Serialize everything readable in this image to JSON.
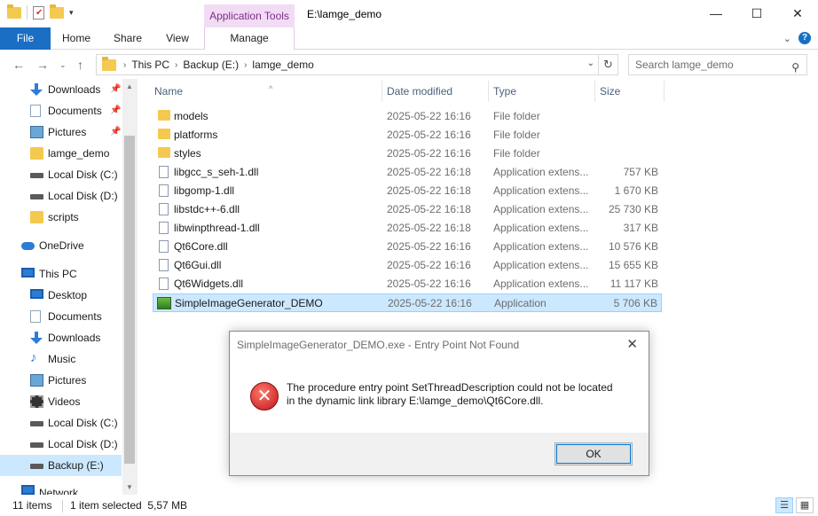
{
  "window": {
    "title": "E:\\lamge_demo",
    "context_tab": "Application Tools",
    "controls": {
      "minimize": "—",
      "maximize": "☐",
      "close": "✕"
    }
  },
  "ribbon": {
    "tabs": [
      "File",
      "Home",
      "Share",
      "View",
      "Manage"
    ]
  },
  "address": {
    "crumbs": [
      "This PC",
      "Backup (E:)",
      "lamge_demo"
    ],
    "search_placeholder": "Search lamge_demo"
  },
  "sidebar": {
    "items": [
      {
        "label": "Downloads",
        "icon": "download-icon",
        "pinned": true
      },
      {
        "label": "Documents",
        "icon": "document-icon",
        "pinned": true
      },
      {
        "label": "Pictures",
        "icon": "pictures-icon",
        "pinned": true
      },
      {
        "label": "lamge_demo",
        "icon": "folder-icon"
      },
      {
        "label": "Local Disk (C:)",
        "icon": "disk-icon"
      },
      {
        "label": "Local Disk (D:)",
        "icon": "disk-icon"
      },
      {
        "label": "scripts",
        "icon": "folder-icon"
      },
      {
        "label": "OneDrive",
        "icon": "onedrive-icon"
      },
      {
        "label": "This PC",
        "icon": "pc-icon"
      },
      {
        "label": "Desktop",
        "icon": "desktop-icon"
      },
      {
        "label": "Documents",
        "icon": "document-icon"
      },
      {
        "label": "Downloads",
        "icon": "download-icon"
      },
      {
        "label": "Music",
        "icon": "music-icon"
      },
      {
        "label": "Pictures",
        "icon": "pictures-icon"
      },
      {
        "label": "Videos",
        "icon": "videos-icon"
      },
      {
        "label": "Local Disk (C:)",
        "icon": "disk-icon"
      },
      {
        "label": "Local Disk (D:)",
        "icon": "disk-icon"
      },
      {
        "label": "Backup (E:)",
        "icon": "disk-icon",
        "selected": true
      },
      {
        "label": "Network",
        "icon": "network-icon"
      }
    ]
  },
  "columns": {
    "name": "Name",
    "date": "Date modified",
    "type": "Type",
    "size": "Size"
  },
  "files": [
    {
      "name": "models",
      "date": "2025-05-22 16:16",
      "type": "File folder",
      "size": "",
      "kind": "folder"
    },
    {
      "name": "platforms",
      "date": "2025-05-22 16:16",
      "type": "File folder",
      "size": "",
      "kind": "folder"
    },
    {
      "name": "styles",
      "date": "2025-05-22 16:16",
      "type": "File folder",
      "size": "",
      "kind": "folder"
    },
    {
      "name": "libgcc_s_seh-1.dll",
      "date": "2025-05-22 16:18",
      "type": "Application extens...",
      "size": "757 KB",
      "kind": "dll"
    },
    {
      "name": "libgomp-1.dll",
      "date": "2025-05-22 16:18",
      "type": "Application extens...",
      "size": "1 670 KB",
      "kind": "dll"
    },
    {
      "name": "libstdc++-6.dll",
      "date": "2025-05-22 16:18",
      "type": "Application extens...",
      "size": "25 730 KB",
      "kind": "dll"
    },
    {
      "name": "libwinpthread-1.dll",
      "date": "2025-05-22 16:18",
      "type": "Application extens...",
      "size": "317 KB",
      "kind": "dll"
    },
    {
      "name": "Qt6Core.dll",
      "date": "2025-05-22 16:16",
      "type": "Application extens...",
      "size": "10 576 KB",
      "kind": "dll"
    },
    {
      "name": "Qt6Gui.dll",
      "date": "2025-05-22 16:16",
      "type": "Application extens...",
      "size": "15 655 KB",
      "kind": "dll"
    },
    {
      "name": "Qt6Widgets.dll",
      "date": "2025-05-22 16:16",
      "type": "Application extens...",
      "size": "11 117 KB",
      "kind": "dll"
    },
    {
      "name": "SimpleImageGenerator_DEMO",
      "date": "2025-05-22 16:16",
      "type": "Application",
      "size": "5 706 KB",
      "kind": "exe",
      "selected": true
    }
  ],
  "status": {
    "count": "11 items",
    "selection": "1 item selected  5,57 MB"
  },
  "dialog": {
    "title": "SimpleImageGenerator_DEMO.exe - Entry Point Not Found",
    "message_line1": "The procedure entry point SetThreadDescription could not be located",
    "message_line2": "in the dynamic link library E:\\lamge_demo\\Qt6Core.dll.",
    "ok_label": "OK"
  }
}
